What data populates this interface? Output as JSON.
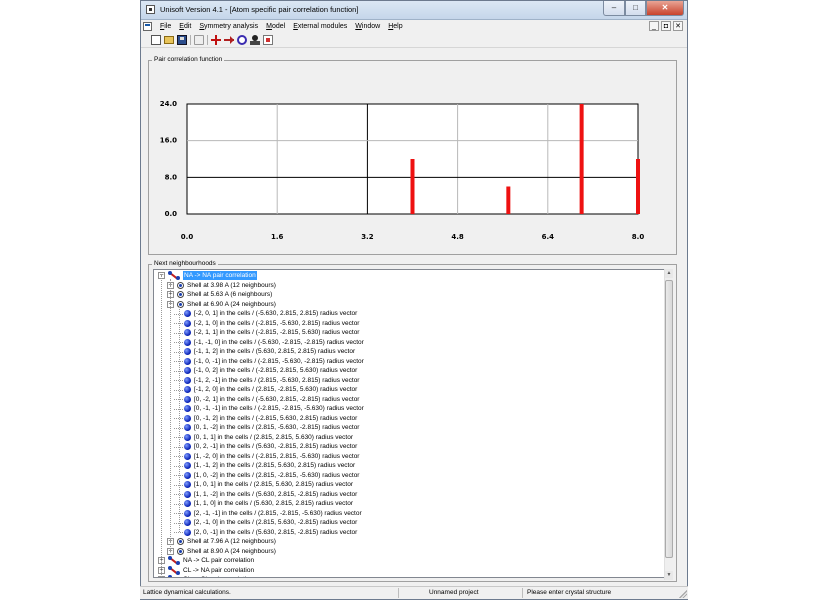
{
  "window": {
    "title": "Unisoft Version 4.1 - [Atom specific pair correlation function]",
    "controls": {
      "minimize": "–",
      "maximize": "□",
      "close": "✕"
    }
  },
  "menu": {
    "items": [
      "File",
      "Edit",
      "Symmetry analysis",
      "Model",
      "External modules",
      "Window",
      "Help"
    ],
    "mdi_controls": [
      "_",
      "◘",
      "✕"
    ]
  },
  "toolbar": {
    "icons": [
      "new-document-icon",
      "open-folder-icon",
      "save-disk-icon",
      "printer-icon",
      "cross-icon",
      "arrow-right-icon",
      "circle-icon",
      "person-icon",
      "document-icon"
    ]
  },
  "chart_panel": {
    "label": "Pair correlation function"
  },
  "chart_data": {
    "type": "bar",
    "x": [
      4.0,
      5.7,
      7.0,
      8.0
    ],
    "values": [
      12,
      6,
      24,
      12
    ],
    "xlim": [
      0.0,
      8.0
    ],
    "ylim": [
      0.0,
      24.0
    ],
    "xticks": [
      "0.0",
      "1.6",
      "3.2",
      "4.8",
      "6.4",
      "8.0"
    ],
    "yticks": [
      "0.0",
      "8.0",
      "16.0",
      "24.0"
    ],
    "grid": true,
    "bar_color": "#ee1111"
  },
  "tree_panel": {
    "label": "Next neighbourhoods"
  },
  "tree": {
    "root": "NA -> NA pair correlation",
    "shells_before": [
      "Shell at 3.98 A (12 neighbours)",
      "Shell at 5.63 A (6 neighbours)"
    ],
    "open_shell": "Shell at 6.90 A (24 neighbours)",
    "atoms": [
      "[-2, 0, 1] in the cells  /  (-5.630, 2.815, 2.815) radius vector",
      "[-2, 1, 0] in the cells  /  (-2.815, -5.630, 2.815) radius vector",
      "[-2, 1, 1] in the cells  /  (-2.815, -2.815, 5.630) radius vector",
      "[-1, -1, 0] in the cells  /  (-5.630, -2.815, -2.815) radius vector",
      "[-1, 1, 2] in the cells  /  (5.630, 2.815, 2.815) radius vector",
      "[-1, 0, -1] in the cells  /  (-2.815, -5.630, -2.815) radius vector",
      "[-1, 0, 2] in the cells  /  (-2.815, 2.815, 5.630) radius vector",
      "[-1, 2, -1] in the cells  /  (2.815, -5.630, 2.815) radius vector",
      "[-1, 2, 0] in the cells  /  (2.815, -2.815, 5.630) radius vector",
      "[0, -2, 1] in the cells  /  (-5.630, 2.815, -2.815) radius vector",
      "[0, -1, -1] in the cells  /  (-2.815, -2.815, -5.630) radius vector",
      "[0, -1, 2] in the cells  /  (-2.815, 5.630, 2.815) radius vector",
      "[0, 1, -2] in the cells  /  (2.815, -5.630, -2.815) radius vector",
      "[0, 1, 1] in the cells  /  (2.815, 2.815, 5.630) radius vector",
      "[0, 2, -1] in the cells  /  (5.630, -2.815, 2.815) radius vector",
      "[1, -2, 0] in the cells  /  (-2.815, 2.815, -5.630) radius vector",
      "[1, -1, 2] in the cells  /  (2.815, 5.630, 2.815) radius vector",
      "[1, 0, -2] in the cells  /  (2.815, -2.815, -5.630) radius vector",
      "[1, 0, 1] in the cells  /  (2.815, 5.630, 2.815) radius vector",
      "[1, 1, -2] in the cells  /  (5.630, 2.815, -2.815) radius vector",
      "[1, 1, 0] in the cells  /  (5.630, 2.815, 2.815) radius vector",
      "[2, -1, -1] in the cells  /  (2.815, -2.815, -5.630) radius vector",
      "[2, -1, 0] in the cells  /  (2.815, 5.630, -2.815) radius vector",
      "[2, 0, -1] in the cells  /  (5.630, 2.815, -2.815) radius vector"
    ],
    "shells_after": [
      "Shell at 7.96 A (12 neighbours)",
      "Shell at 8.90 A (24 neighbours)"
    ],
    "other_pairs": [
      "NA -> CL pair correlation",
      "CL -> NA pair correlation",
      "CL -> CL pair correlation"
    ]
  },
  "status": {
    "left": "Lattice dynamical calculations.",
    "middle": "Unnamed project",
    "right": "Please enter crystal structure"
  }
}
